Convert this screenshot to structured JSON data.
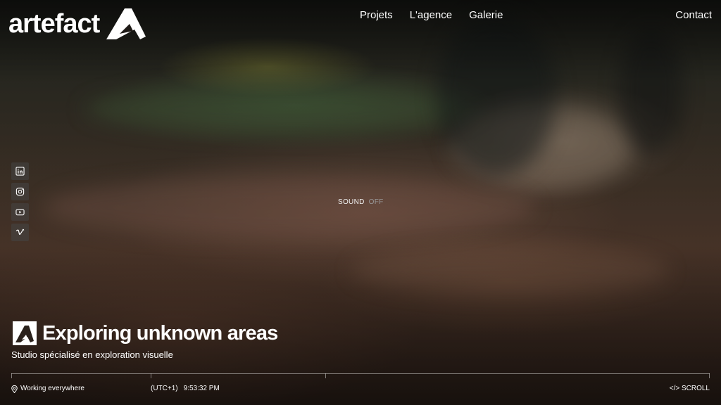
{
  "header": {
    "logo_text": "artefact",
    "nav": [
      "Projets",
      "L'agence",
      "Galerie"
    ],
    "contact": "Contact"
  },
  "social": [
    "linkedin-icon",
    "instagram-icon",
    "youtube-icon",
    "vimeo-icon"
  ],
  "sound": {
    "label": "SOUND",
    "state": "OFF"
  },
  "hero": {
    "title": "Exploring unknown areas",
    "subtitle": "Studio spécialisé en exploration visuelle"
  },
  "footer": {
    "location": "Working everywhere",
    "timezone": "(UTC+1)",
    "time": "9:53:32 PM",
    "scroll": "</> SCROLL"
  },
  "colors": {
    "text": "#ffffff",
    "muted": "#9a9a9a"
  }
}
